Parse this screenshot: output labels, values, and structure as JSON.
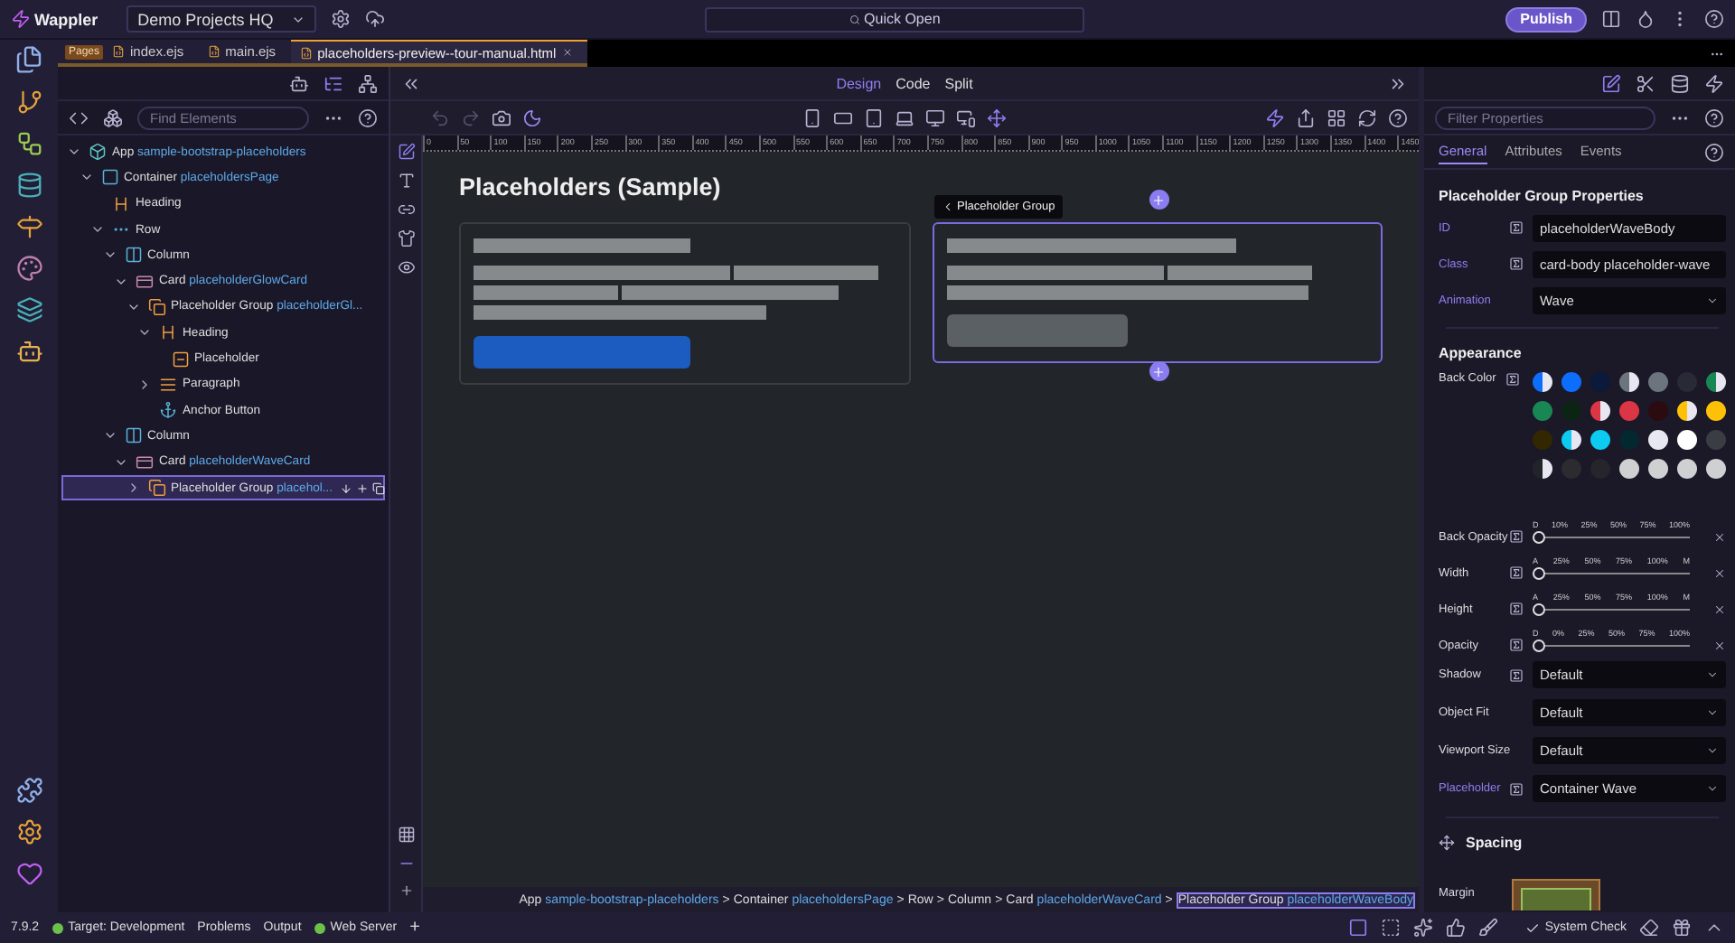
{
  "topbar": {
    "app_name": "Wappler",
    "project": "Demo Projects HQ",
    "quick_open": "Quick Open",
    "publish": "Publish"
  },
  "tabs": [
    {
      "label": "Pages",
      "kind": "badge",
      "selected": false
    },
    {
      "label": "index.ejs",
      "kind": "file",
      "selected": false
    },
    {
      "label": "main.ejs",
      "kind": "file",
      "selected": false
    },
    {
      "label": "placeholders-preview--tour-manual.html",
      "kind": "file",
      "selected": true
    }
  ],
  "tree_panel": {
    "search": {
      "placeholder": "Find Elements"
    },
    "tree": [
      {
        "label": "App",
        "ref": "sample-bootstrap-placeholders",
        "kind": "app",
        "expanded": true,
        "selected": false,
        "children": [
          {
            "label": "Container",
            "ref": "placeholdersPage",
            "kind": "container",
            "expanded": true,
            "selected": false,
            "children": [
              {
                "label": "Heading",
                "kind": "heading",
                "selected": false
              },
              {
                "label": "Row",
                "kind": "row",
                "expanded": true,
                "selected": false,
                "children": [
                  {
                    "label": "Column",
                    "kind": "column",
                    "expanded": true,
                    "selected": false,
                    "children": [
                      {
                        "label": "Card",
                        "ref": "placeholderGlowCard",
                        "kind": "card",
                        "expanded": true,
                        "selected": false,
                        "children": [
                          {
                            "label": "Placeholder Group",
                            "ref": "placeholderGl...",
                            "kind": "group",
                            "expanded": true,
                            "selected": false,
                            "children": [
                              {
                                "label": "Heading",
                                "kind": "heading",
                                "expanded": true,
                                "selected": false,
                                "children": [
                                  {
                                    "label": "Placeholder",
                                    "kind": "placeholder",
                                    "selected": false
                                  }
                                ]
                              },
                              {
                                "label": "Paragraph",
                                "kind": "paragraph",
                                "expanded": false,
                                "selected": false
                              },
                              {
                                "label": "Anchor Button",
                                "kind": "anchor",
                                "selected": false
                              }
                            ]
                          }
                        ]
                      }
                    ]
                  },
                  {
                    "label": "Column",
                    "kind": "column",
                    "expanded": true,
                    "selected": false,
                    "children": [
                      {
                        "label": "Card",
                        "ref": "placeholderWaveCard",
                        "kind": "card",
                        "expanded": true,
                        "selected": false,
                        "children": [
                          {
                            "label": "Placeholder Group",
                            "ref": "placehol...",
                            "kind": "group",
                            "expanded": false,
                            "selected": true
                          }
                        ]
                      }
                    ]
                  }
                ]
              }
            ]
          }
        ]
      }
    ]
  },
  "canvas": {
    "views": [
      {
        "label": "Design",
        "selected": true
      },
      {
        "label": "Code",
        "selected": false
      },
      {
        "label": "Split",
        "selected": false
      }
    ],
    "ruler": [
      "0",
      "50",
      "100",
      "150",
      "200",
      "250",
      "300",
      "350",
      "400",
      "450",
      "500",
      "550",
      "600",
      "650",
      "700",
      "750",
      "800",
      "850",
      "900",
      "950",
      "1000",
      "1050",
      "1100",
      "1150",
      "1200",
      "1250",
      "1300",
      "1350",
      "1400",
      "1450"
    ],
    "page_title": "Placeholders (Sample)",
    "selection_tag": "Placeholder Group",
    "cards": [
      {
        "kind": "glow",
        "selected": false
      },
      {
        "kind": "wave",
        "selected": true
      }
    ],
    "breadcrumb_separator": ">",
    "breadcrumb": [
      {
        "label": "App",
        "ref": "sample-bootstrap-placeholders",
        "selected": false
      },
      {
        "label": "Container",
        "ref": "placeholdersPage",
        "selected": false
      },
      {
        "label": "Row",
        "selected": false
      },
      {
        "label": "Column",
        "selected": false
      },
      {
        "label": "Card",
        "ref": "placeholderWaveCard",
        "selected": false
      },
      {
        "label": "Placeholder Group",
        "ref": "placeholderWaveBody",
        "selected": true
      }
    ]
  },
  "properties": {
    "filter": {
      "placeholder": "Filter Properties"
    },
    "tabs": [
      {
        "label": "General",
        "selected": true
      },
      {
        "label": "Attributes",
        "selected": false
      },
      {
        "label": "Events",
        "selected": false
      }
    ],
    "title": "Placeholder Group Properties",
    "fields": [
      {
        "label": "ID",
        "set": true,
        "bindable": true,
        "kind": "text",
        "value": "placeholderWaveBody"
      },
      {
        "label": "Class",
        "set": true,
        "bindable": true,
        "kind": "text",
        "value": "card-body placeholder-wave"
      },
      {
        "label": "Animation",
        "set": true,
        "bindable": false,
        "kind": "select",
        "value": "Wave"
      }
    ],
    "appearance": {
      "title": "Appearance",
      "back_color_label": "Back Color",
      "swatches": [
        {
          "kind": "half",
          "color": "#0d6efd"
        },
        {
          "kind": "solid",
          "color": "#0d6efd"
        },
        {
          "kind": "solid",
          "color": "#0b1a3a"
        },
        {
          "kind": "half",
          "color": "#6c757d"
        },
        {
          "kind": "solid",
          "color": "#6c757d"
        },
        {
          "kind": "solid",
          "color": "#2a2936"
        },
        {
          "kind": "half",
          "color": "#198754"
        },
        {
          "kind": "solid",
          "color": "#198754"
        },
        {
          "kind": "solid",
          "color": "#0b2414"
        },
        {
          "kind": "half",
          "color": "#dc3545"
        },
        {
          "kind": "solid",
          "color": "#dc3545"
        },
        {
          "kind": "solid",
          "color": "#2c0b10"
        },
        {
          "kind": "half",
          "color": "#ffc107"
        },
        {
          "kind": "solid",
          "color": "#ffc107"
        },
        {
          "kind": "solid",
          "color": "#332701"
        },
        {
          "kind": "half",
          "color": "#0dcaf0"
        },
        {
          "kind": "solid",
          "color": "#0dcaf0"
        },
        {
          "kind": "solid",
          "color": "#032830"
        },
        {
          "kind": "half",
          "color": "#e8e8f0"
        },
        {
          "kind": "solid",
          "color": "#ffffff"
        },
        {
          "kind": "solid",
          "color": "#3a3d44"
        },
        {
          "kind": "half",
          "color": "#212529"
        },
        {
          "kind": "solid",
          "color": "#2b2b30"
        },
        {
          "kind": "solid",
          "color": "#25252b"
        },
        {
          "kind": "solid",
          "color": "#cfd0d2"
        },
        {
          "kind": "solid",
          "color": "#cfd0d2"
        },
        {
          "kind": "solid",
          "color": "#cfd0d2"
        },
        {
          "kind": "solid",
          "color": "#cfd0d2"
        }
      ],
      "sliders": [
        {
          "label": "Back Opacity",
          "ticks": [
            "D",
            "10%",
            "25%",
            "50%",
            "75%",
            "100%"
          ],
          "level": 0
        },
        {
          "label": "Width",
          "ticks": [
            "A",
            "25%",
            "50%",
            "75%",
            "100%",
            "M"
          ],
          "level": 0
        },
        {
          "label": "Height",
          "ticks": [
            "A",
            "25%",
            "50%",
            "75%",
            "100%",
            "M"
          ],
          "level": 0
        },
        {
          "label": "Opacity",
          "ticks": [
            "D",
            "0%",
            "25%",
            "50%",
            "75%",
            "100%"
          ],
          "level": 0
        }
      ],
      "selects": [
        {
          "label": "Shadow",
          "set": false,
          "bindable": true,
          "value": "Default"
        },
        {
          "label": "Object Fit",
          "set": false,
          "bindable": false,
          "value": "Default"
        },
        {
          "label": "Viewport Size",
          "set": false,
          "bindable": false,
          "value": "Default"
        },
        {
          "label": "Placeholder",
          "set": true,
          "bindable": true,
          "value": "Container Wave"
        }
      ]
    },
    "spacing": {
      "title": "Spacing",
      "margin_label": "Margin"
    }
  },
  "status_bar": {
    "version": "7.9.2",
    "target": "Target: Development",
    "items": [
      "Problems",
      "Output"
    ],
    "server": "Web Server",
    "add": "+",
    "system_check": "System Check"
  }
}
